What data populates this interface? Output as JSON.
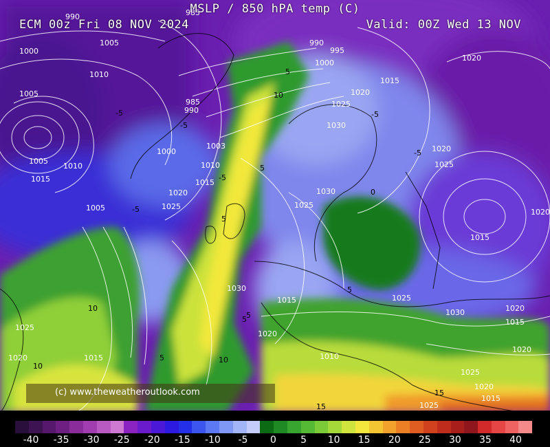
{
  "header": {
    "title": "MSLP / 850 hPA temp (C)",
    "run": "ECM 00z Fri 08 NOV 2024",
    "valid": "Valid: 00Z Wed 13 NOV"
  },
  "credit": "(c) www.theweatheroutlook.com",
  "isobar_labels": [
    {
      "text": "990"
    },
    {
      "text": "985"
    },
    {
      "text": "1000"
    },
    {
      "text": "1005"
    },
    {
      "text": "1010"
    },
    {
      "text": "1005"
    },
    {
      "text": "1005"
    },
    {
      "text": "1015"
    },
    {
      "text": "1010"
    },
    {
      "text": "1005"
    },
    {
      "text": "1000"
    },
    {
      "text": "985"
    },
    {
      "text": "990"
    },
    {
      "text": "1003"
    },
    {
      "text": "1010"
    },
    {
      "text": "1015"
    },
    {
      "text": "1020"
    },
    {
      "text": "1025"
    },
    {
      "text": "990"
    },
    {
      "text": "995"
    },
    {
      "text": "1000"
    },
    {
      "text": "1015"
    },
    {
      "text": "1020"
    },
    {
      "text": "1025"
    },
    {
      "text": "1030"
    },
    {
      "text": "1030"
    },
    {
      "text": "1025"
    },
    {
      "text": "1020"
    },
    {
      "text": "1025"
    },
    {
      "text": "1020"
    },
    {
      "text": "1020"
    },
    {
      "text": "1015"
    },
    {
      "text": "1030"
    },
    {
      "text": "1015"
    },
    {
      "text": "1025"
    },
    {
      "text": "1020"
    },
    {
      "text": "1030"
    },
    {
      "text": "1020"
    },
    {
      "text": "1015"
    },
    {
      "text": "1025"
    },
    {
      "text": "1020"
    },
    {
      "text": "1015"
    },
    {
      "text": "1010"
    },
    {
      "text": "1020"
    },
    {
      "text": "1025"
    },
    {
      "text": "1020"
    },
    {
      "text": "1015"
    },
    {
      "text": "1025"
    },
    {
      "text": "1020"
    }
  ],
  "temp_labels": [
    {
      "text": "-5"
    },
    {
      "text": "-5"
    },
    {
      "text": "-5"
    },
    {
      "text": "5"
    },
    {
      "text": "10"
    },
    {
      "text": "5"
    },
    {
      "text": "5"
    },
    {
      "text": "5"
    },
    {
      "text": "10"
    },
    {
      "text": "10"
    },
    {
      "text": "5"
    },
    {
      "text": "-5"
    },
    {
      "text": "0"
    },
    {
      "text": "-5"
    },
    {
      "text": "-5"
    },
    {
      "text": "5"
    },
    {
      "text": "5"
    },
    {
      "text": "10"
    },
    {
      "text": "15"
    },
    {
      "text": "15"
    }
  ],
  "scale": {
    "colors": [
      "#2a0f3c",
      "#3d1352",
      "#55186b",
      "#6e1f82",
      "#8a2d9a",
      "#a23db0",
      "#b95ac2",
      "#cf7ad2",
      "#8a23c2",
      "#6a1ccc",
      "#4a18d6",
      "#2c1ae0",
      "#2430e8",
      "#3c55ee",
      "#5c78f2",
      "#7f98f5",
      "#a2b5f7",
      "#c4cdfa",
      "#0b6a14",
      "#1f8a24",
      "#37a52f",
      "#55b935",
      "#7acb37",
      "#a5d93a",
      "#cfe53d",
      "#f3e73d",
      "#f4c533",
      "#f0a22c",
      "#ea7f26",
      "#e05d21",
      "#d2411d",
      "#c02c1b",
      "#a81e1b",
      "#8f161c",
      "#d22a2a",
      "#e54545",
      "#f06363",
      "#f58a8a"
    ],
    "ticks": [
      "-40",
      "-35",
      "-30",
      "-25",
      "-20",
      "-15",
      "-10",
      "-5",
      "0",
      "5",
      "10",
      "15",
      "20",
      "25",
      "30",
      "35",
      "40"
    ]
  }
}
